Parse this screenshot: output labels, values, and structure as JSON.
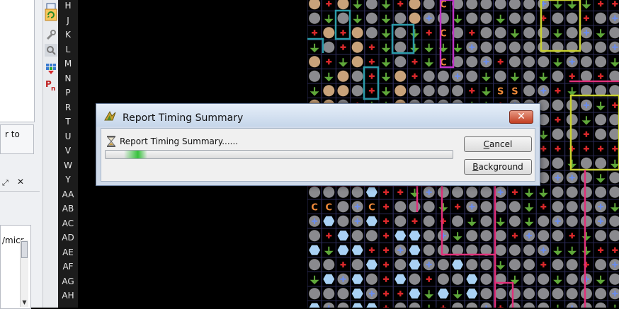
{
  "left_panel": {
    "message_fragment": "r to",
    "list_fragment": "/micr",
    "restore_glyph": "⤢",
    "close_glyph": "✕"
  },
  "toolbar": {
    "icons": [
      "monitor-icon",
      "refresh-icon",
      "wrench-icon",
      "magnify-icon",
      "grid-icon",
      "pin-label-icon"
    ]
  },
  "row_labels": [
    "H",
    "J",
    "K",
    "L",
    "M",
    "N",
    "P",
    "R",
    "T",
    "U",
    "V",
    "W",
    "Y",
    "AA",
    "AB",
    "AC",
    "AD",
    "AE",
    "AF",
    "AG",
    "AH"
  ],
  "dialog": {
    "title": "Report Timing Summary",
    "message": "Report Timing Summary......",
    "progress": 0.12,
    "cancel_label": "Cancel",
    "background_label": "Background",
    "close_glyph": "✕"
  },
  "grid": {
    "site_letters": [
      "C",
      "S"
    ],
    "colors": {
      "site_tan": "#c8a27a",
      "site_gray": "#8a8a8e",
      "site_light_blue": "#a9d1f4",
      "cell_bg": "#000000",
      "grid_line": "#2a2a55",
      "ground_green": "#5fa83a",
      "power_red": "#d8282a",
      "signal_blue": "#6a8df0",
      "clock_orange": "#f08a3a",
      "region_purple": "#c032c8",
      "region_teal": "#2a9aa8",
      "region_yellow": "#c8d030",
      "region_pink": "#e0307a"
    }
  }
}
